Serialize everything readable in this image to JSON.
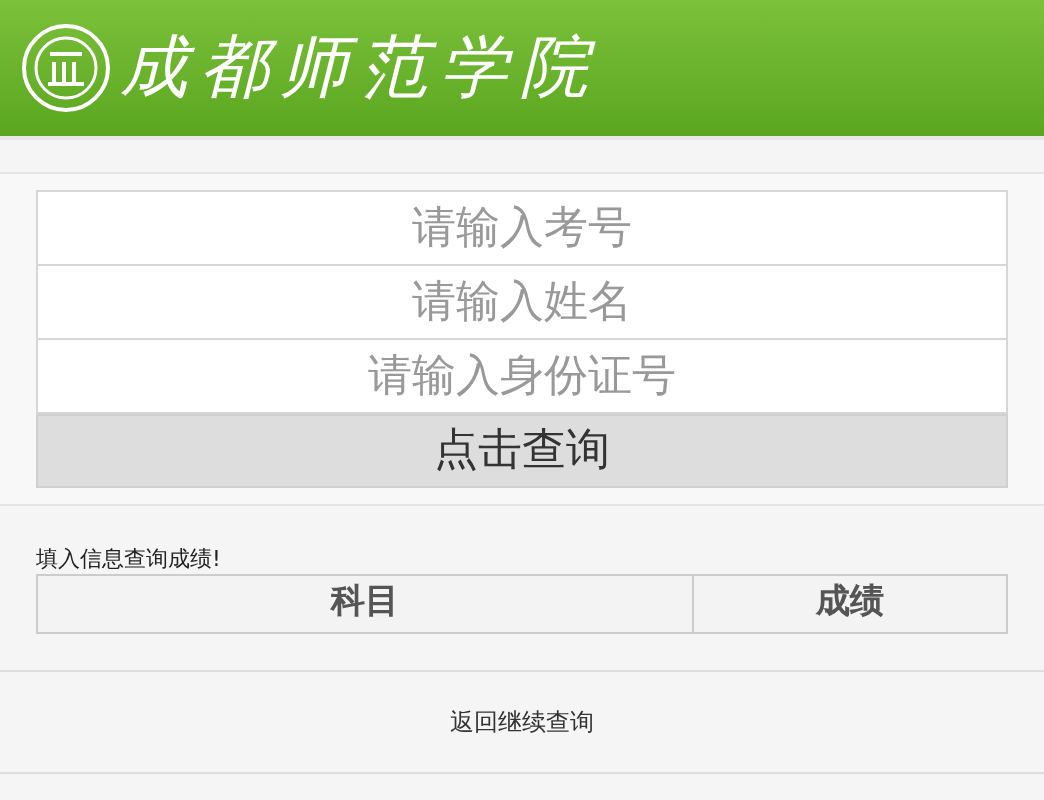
{
  "header": {
    "logo_text": "成都师范学院"
  },
  "form": {
    "fields": [
      {
        "placeholder": "请输入考号"
      },
      {
        "placeholder": "请输入姓名"
      },
      {
        "placeholder": "请输入身份证号"
      }
    ],
    "submit": "点击查询"
  },
  "message": "填入信息查询成绩!",
  "table": {
    "columns": [
      "科目",
      "成绩"
    ]
  },
  "footer_link": "返回继续查询"
}
